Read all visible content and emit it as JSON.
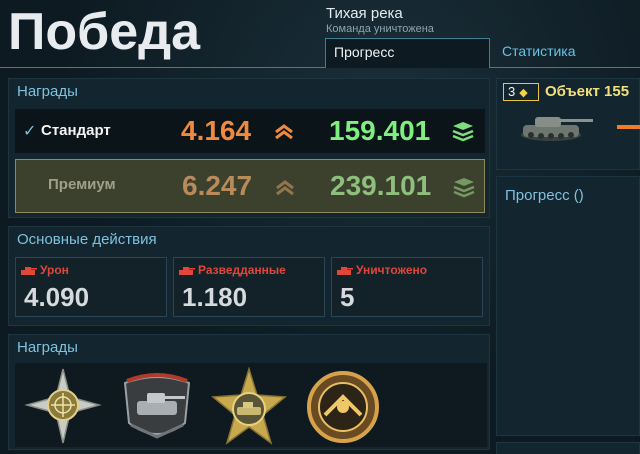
{
  "header": {
    "result": "Победа",
    "map_name": "Тихая река",
    "mode_name": "Команда уничтожена"
  },
  "tabs": [
    {
      "label": "Прогресс",
      "active": true
    },
    {
      "label": "Статистика",
      "active": false
    }
  ],
  "awards": {
    "title": "Награды",
    "standard": {
      "label": "Стандарт",
      "experience": "4.164",
      "credits": "159.401",
      "selected": true
    },
    "premium": {
      "label": "Премиум",
      "experience": "6.247",
      "credits": "239.101",
      "selected": false
    }
  },
  "actions": {
    "title": "Основные действия",
    "items": [
      {
        "label": "Урон",
        "value": "4.090",
        "icon": "damage-icon"
      },
      {
        "label": "Разведданные",
        "value": "1.180",
        "icon": "spotting-icon"
      },
      {
        "label": "Уничтожено",
        "value": "5",
        "icon": "destroyed-icon"
      }
    ]
  },
  "medals": {
    "title": "Награды",
    "items": [
      "star-medal-icon",
      "tank-emblem-medal-icon",
      "gold-star-medal-icon",
      "gold-round-medal-icon"
    ]
  },
  "vehicle": {
    "tier": "3",
    "name": "Объект 155"
  },
  "progress": {
    "title": "Прогресс ()"
  },
  "colors": {
    "experience": "#f08a3e",
    "credits": "#7ff07f",
    "accent": "#7fc1df",
    "damage": "#e0463a"
  }
}
